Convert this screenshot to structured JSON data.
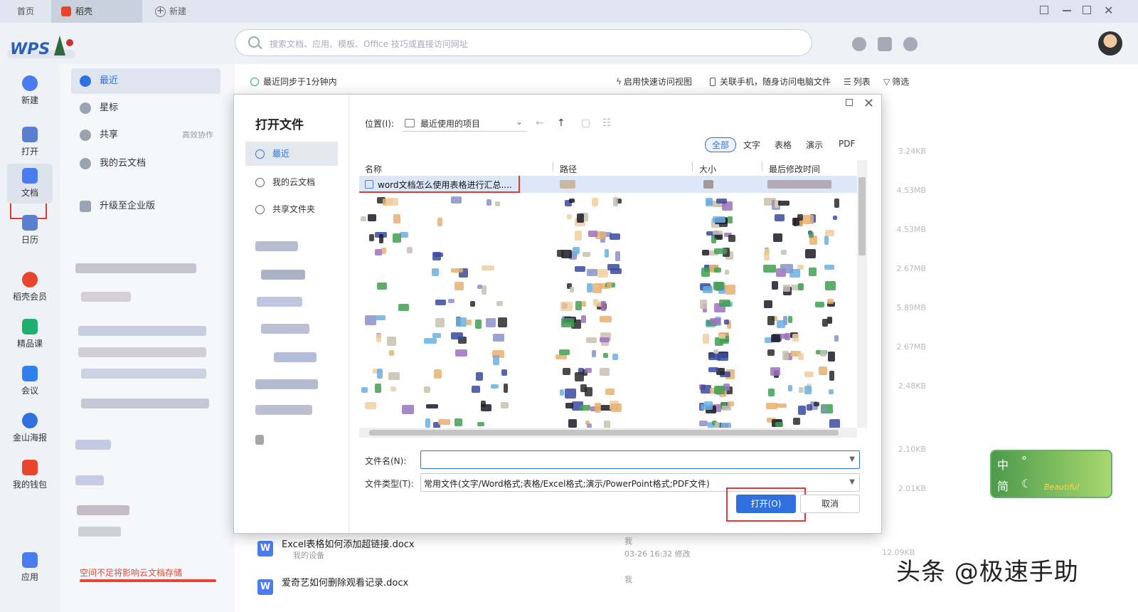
{
  "tabs": {
    "home": "首页",
    "doc": "稻壳",
    "new": "新建"
  },
  "search": {
    "placeholder": "搜索文档、应用、模板、Office 技巧或直接访问网址"
  },
  "rail": {
    "new": "新建",
    "open": "打开",
    "docs": "文档",
    "calendar": "日历",
    "docer": "稻壳会员",
    "course": "精品课",
    "meeting": "会议",
    "poster": "金山海报",
    "wallet": "我的钱包",
    "apps": "应用"
  },
  "side": {
    "recent": "最近",
    "star": "星标",
    "share": "共享",
    "share_extra": "高效协作",
    "cloud": "我的云文档",
    "upgrade": "升级至企业版",
    "storage_warning": "空间不足将影响云文档存储"
  },
  "main": {
    "sync_status": "最近同步于1分钟内",
    "quick_view": "启用快速访问视图",
    "phone_link": "关联手机，随身访问电脑文件",
    "list_view": "列表",
    "filter": "筛选",
    "sizes": [
      "3.24KB",
      "4.53MB",
      "4.53MB",
      "2.67MB",
      "5.89MB",
      "2.67MB",
      "2.48KB",
      "2.10KB",
      "2.01KB"
    ],
    "files": [
      {
        "name": "Excel表格如何添加超链接.docx",
        "location": "我的设备",
        "owner": "我",
        "time": "03-26 16:32 修改",
        "size": "12.09KB"
      },
      {
        "name": "爱奇艺如何删除观看记录.docx",
        "owner": "我"
      }
    ]
  },
  "dialog": {
    "title": "打开文件",
    "nav": {
      "recent": "最近",
      "cloud": "我的云文档",
      "shared": "共享文件夹"
    },
    "location_label": "位置(I):",
    "location_value": "最近使用的项目",
    "filters": {
      "all": "全部",
      "text": "文字",
      "table": "表格",
      "present": "演示",
      "pdf": "PDF"
    },
    "columns": {
      "name": "名称",
      "path": "路径",
      "size": "大小",
      "modified": "最后修改时间"
    },
    "first_file": "word文档怎么使用表格进行汇总....",
    "filename_label": "文件名(N):",
    "filename_value": "",
    "filetype_label": "文件类型(T):",
    "filetype_value": "常用文件(文字/Word格式;表格/Excel格式;演示/PowerPoint格式;PDF文件)",
    "open_button": "打开(O)",
    "cancel_button": "取消"
  },
  "ime": {
    "zh": "中",
    "simp": "简",
    "script": "Beautiful"
  },
  "watermark": "头条 @极速手助"
}
